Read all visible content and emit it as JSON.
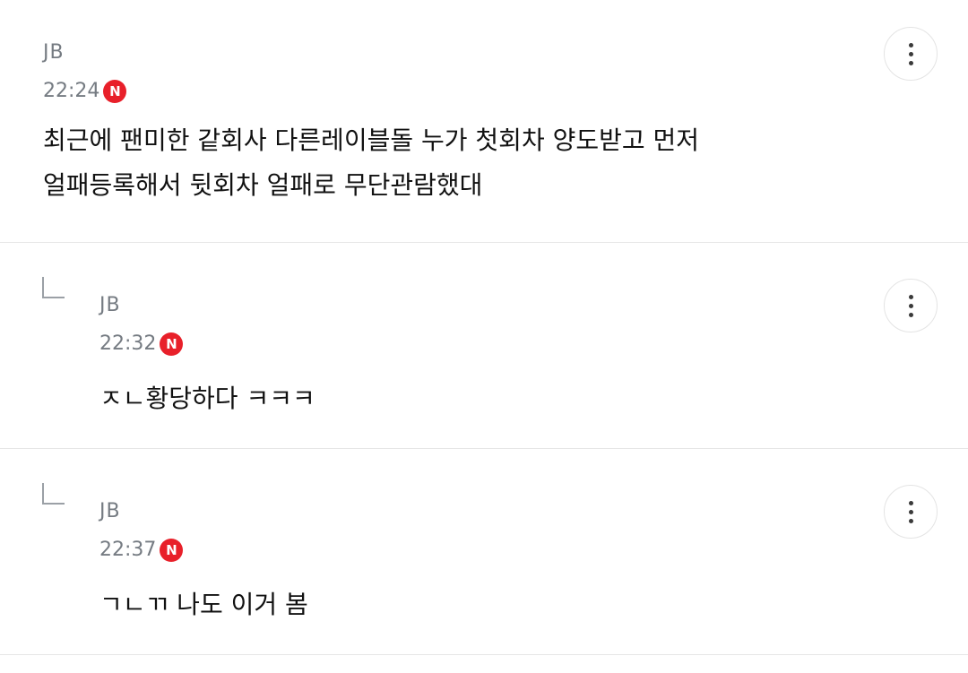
{
  "comments": [
    {
      "author": "JB",
      "time": "22:24",
      "badge": "N",
      "text": "최근에 팬미한 같회사 다른레이블돌 누가 첫회차 양도받고 먼저\n얼패등록해서 뒷회차 얼패로 무단관람했대",
      "is_reply": false
    },
    {
      "author": "JB",
      "time": "22:32",
      "badge": "N",
      "text": "ㅈㄴ황당하다 ㅋㅋㅋ",
      "is_reply": true
    },
    {
      "author": "JB",
      "time": "22:37",
      "badge": "N",
      "text": "ㄱㄴㄲ 나도 이거 봄",
      "is_reply": true
    }
  ],
  "icons": {
    "more": "more-vertical-icon",
    "reply": "reply-arrow-icon",
    "new": "new-badge-icon"
  },
  "colors": {
    "badge": "#e8202a",
    "meta_text": "#757b82",
    "divider": "#e6e6e6"
  }
}
